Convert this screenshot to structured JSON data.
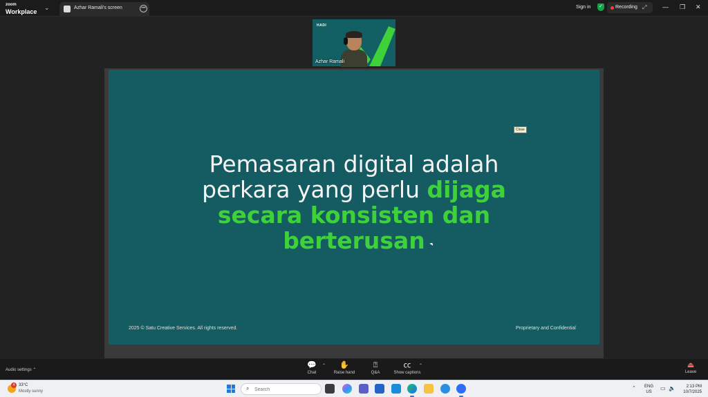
{
  "window": {
    "brand_top": "zoom",
    "brand_bottom": "Workplace",
    "tab_title": "Azhar Ramali's screen",
    "sign_in": "Sign in",
    "recording_label": "Recording"
  },
  "video": {
    "participant_name": "Azhar Ramali",
    "logo_text": "HADI"
  },
  "slide": {
    "line1": "Pemasaran digital adalah",
    "line2_plain": "perkara yang perlu ",
    "line2_highlight": "dijaga",
    "line3": "secara konsisten dan",
    "line4": "berterusan",
    "footer_left": "2025 © Satu Creative Services. All rights reserved.",
    "footer_right": "Proprietary and Confidential",
    "close_tag": "Close",
    "highlight_color": "#3ed13a",
    "background_color": "#145c61"
  },
  "toolbar": {
    "audio_settings": "Audio settings",
    "chat": "Chat",
    "raise_hand": "Raise hand",
    "qa": "Q&A",
    "show_captions": "Show captions",
    "leave": "Leave"
  },
  "taskbar": {
    "weather_badge": "4",
    "temperature": "33°C",
    "weather_desc": "Mostly sunny",
    "search_placeholder": "Search",
    "lang_top": "ENG",
    "lang_bottom": "US",
    "time": "2:13 PM",
    "date": "10/7/2025",
    "apps": [
      "file-explorer",
      "copilot",
      "teams",
      "store",
      "mail",
      "edge",
      "folder",
      "ie",
      "zoom"
    ]
  }
}
